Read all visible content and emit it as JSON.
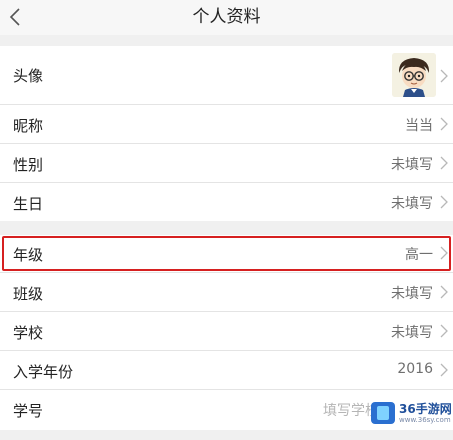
{
  "header": {
    "title": "个人资料"
  },
  "group1": {
    "avatar_label": "头像",
    "rows": [
      {
        "label": "昵称",
        "value": "当当"
      },
      {
        "label": "性别",
        "value": "未填写"
      },
      {
        "label": "生日",
        "value": "未填写"
      }
    ]
  },
  "group2": {
    "rows": [
      {
        "label": "年级",
        "value": "高一"
      },
      {
        "label": "班级",
        "value": "未填写"
      },
      {
        "label": "学校",
        "value": "未填写"
      },
      {
        "label": "入学年份",
        "value": "2016"
      },
      {
        "label": "学号",
        "value": "填写学校"
      }
    ]
  },
  "watermark": {
    "text": "36手游网",
    "sub": "www.36sy.com"
  },
  "colors": {
    "highlight": "#d62020",
    "background": "#f0f0f0"
  }
}
